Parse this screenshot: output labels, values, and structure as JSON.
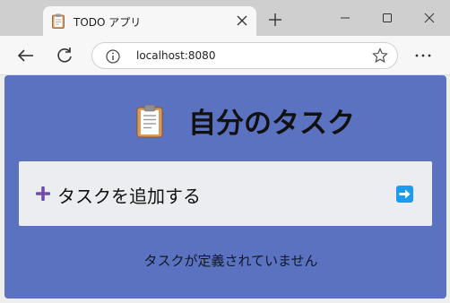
{
  "browser": {
    "tab": {
      "title": "TODO アプリ",
      "favicon": "clipboard-icon",
      "close_icon": "close-icon"
    },
    "new_tab_icon": "plus-icon",
    "window_controls": [
      "minimize-icon",
      "maximize-icon",
      "close-icon"
    ],
    "toolbar": {
      "back_icon": "arrow-left-icon",
      "refresh_icon": "refresh-icon",
      "info_icon": "info-icon",
      "url": "localhost:8080",
      "favorite_icon": "star-icon",
      "menu_icon": "more-horizontal-icon"
    }
  },
  "app": {
    "title": "自分のタスク",
    "title_icon": "clipboard-icon",
    "add_task": {
      "label": "タスクを追加する",
      "icon": "plus-icon",
      "submit_icon": "arrow-right-icon"
    },
    "empty_message": "タスクが定義されていません",
    "colors": {
      "background": "#5b72c0",
      "panel": "#ecedf1",
      "plus": "#6b4fa8",
      "submit": "#1d9bf0"
    }
  }
}
